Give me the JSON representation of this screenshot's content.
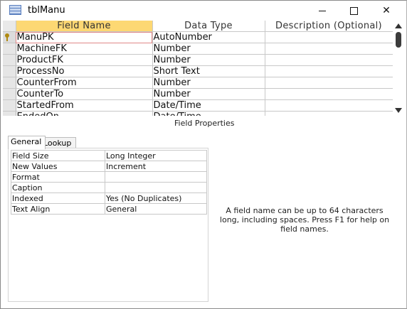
{
  "window": {
    "title": "tblManu"
  },
  "titlebar_buttons": {
    "minimize": "minimize-icon",
    "maximize": "maximize-icon",
    "close": "✕"
  },
  "grid": {
    "headers": {
      "field_name": "Field Name",
      "data_type": "Data Type",
      "description": "Description (Optional)"
    },
    "rows": [
      {
        "name": "ManuPK",
        "type": "AutoNumber",
        "description": "",
        "primary_key": true
      },
      {
        "name": "MachineFK",
        "type": "Number",
        "description": ""
      },
      {
        "name": "ProductFK",
        "type": "Number",
        "description": ""
      },
      {
        "name": "ProcessNo",
        "type": "Short Text",
        "description": ""
      },
      {
        "name": "CounterFrom",
        "type": "Number",
        "description": ""
      },
      {
        "name": "CounterTo",
        "type": "Number",
        "description": ""
      },
      {
        "name": "StartedFrom",
        "type": "Date/Time",
        "description": ""
      },
      {
        "name": "EndedOn",
        "type": "Date/Time",
        "description": ""
      }
    ]
  },
  "field_properties": {
    "label": "Field Properties",
    "tabs": {
      "general": "General",
      "lookup": "Lookup"
    },
    "rows": [
      {
        "key": "Field Size",
        "value": "Long Integer"
      },
      {
        "key": "New Values",
        "value": "Increment"
      },
      {
        "key": "Format",
        "value": ""
      },
      {
        "key": "Caption",
        "value": ""
      },
      {
        "key": "Indexed",
        "value": "Yes (No Duplicates)"
      },
      {
        "key": "Text Align",
        "value": "General"
      }
    ],
    "help": "A field name can be up to 64 characters long, including spaces. Press F1 for help on field names."
  },
  "colors": {
    "header_highlight": "#fdd873",
    "grid_line": "#c8c8c8"
  }
}
